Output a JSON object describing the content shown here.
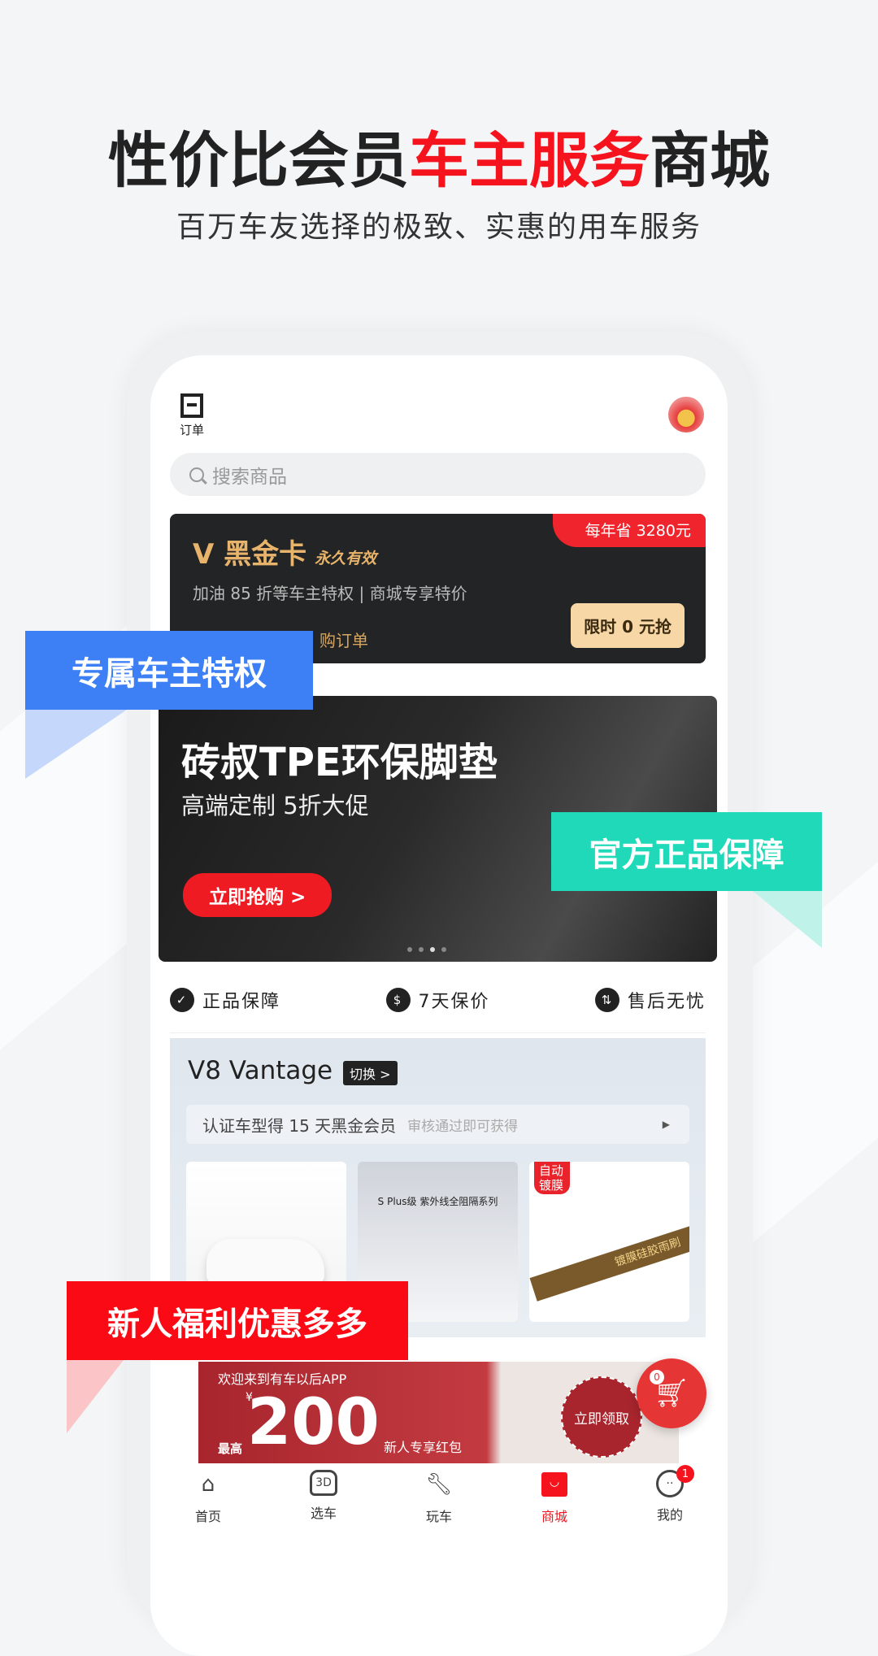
{
  "headline": {
    "part1": "性价比会员",
    "part2": "车主服务",
    "part3": "商城",
    "subtitle": "百万车友选择的极致、实惠的用车服务"
  },
  "callouts": {
    "blue": "专属车主特权",
    "green": "官方正品保障",
    "red": "新人福利优惠多多"
  },
  "header": {
    "order_label": "订单",
    "search_placeholder": "搜索商品"
  },
  "vip_card": {
    "brand": "V 黑金卡",
    "validity": "永久有效",
    "savings": "每年省 3280元",
    "desc": "加油 85 折等车主特权 | 商城专享特价",
    "orders": "购订单",
    "button": "限时 0 元抢"
  },
  "banner": {
    "title": "砖叔TPE环保脚垫",
    "subtitle": "高端定制 5折大促",
    "button": "立即抢购 >"
  },
  "guarantees": [
    {
      "icon": "shield-check-icon",
      "label": "正品保障"
    },
    {
      "icon": "diamond-dollar-icon",
      "label": "7天保价"
    },
    {
      "icon": "wrench-circle-icon",
      "label": "售后无忧"
    }
  ],
  "vehicle": {
    "name": "V8 Vantage",
    "switch": "切换 >",
    "cert": "认证车型得 15 天黑金会员",
    "cert_hint": "审核通过即可获得",
    "products": [
      {
        "tag": ""
      },
      {
        "tag": "",
        "caption": "S Plus级 紫外线全阻隔系列"
      },
      {
        "tag": "自动镀膜",
        "caption": "镀膜硅胶雨刷"
      }
    ]
  },
  "red_packet": {
    "welcome": "欢迎来到有车以后APP",
    "currency": "¥",
    "prefix": "最高",
    "amount": "200",
    "label": "新人专享红包",
    "button": "立即领取"
  },
  "cart": {
    "count": "0"
  },
  "tabbar": [
    {
      "label": "首页",
      "icon": "home-icon"
    },
    {
      "label": "选车",
      "icon": "car-3d-icon"
    },
    {
      "label": "玩车",
      "icon": "wrench-icon"
    },
    {
      "label": "商城",
      "icon": "shopping-bag-icon",
      "active": true
    },
    {
      "label": "我的",
      "icon": "profile-icon",
      "badge": "1"
    }
  ],
  "colors": {
    "accent": "#f5141e",
    "blue": "#3d7ff5",
    "green": "#1fd9b8"
  }
}
